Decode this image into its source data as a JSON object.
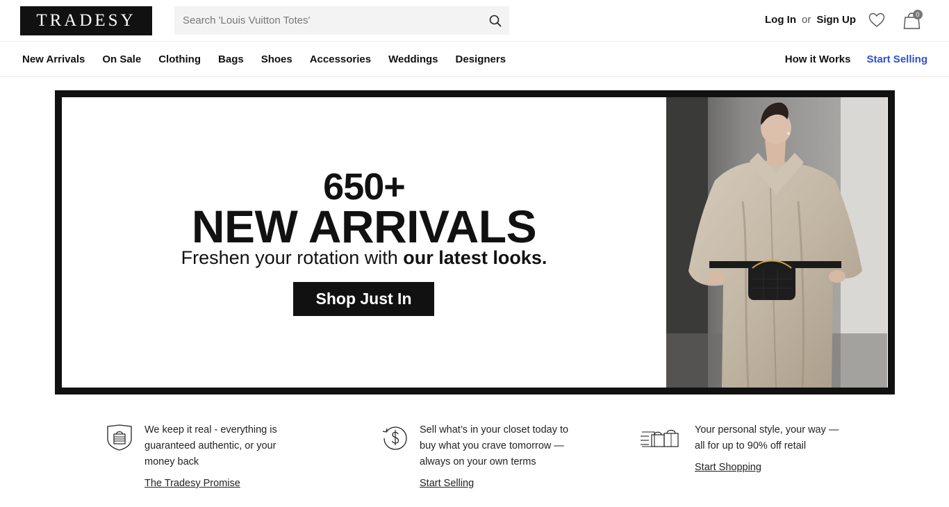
{
  "header": {
    "logo_text": "TRADESY",
    "search_placeholder": "Search 'Louis Vuitton Totes'",
    "search_icon": "search-icon",
    "login_label": "Log In",
    "or_label": "or",
    "signup_label": "Sign Up",
    "favorites_icon": "heart-icon",
    "cart_icon": "shopping-bag-icon",
    "cart_count": "0"
  },
  "nav": {
    "items": [
      {
        "label": "New Arrivals"
      },
      {
        "label": "On Sale"
      },
      {
        "label": "Clothing"
      },
      {
        "label": "Bags"
      },
      {
        "label": "Shoes"
      },
      {
        "label": "Accessories"
      },
      {
        "label": "Weddings"
      },
      {
        "label": "Designers"
      }
    ],
    "how_it_works": "How it Works",
    "start_selling": "Start Selling",
    "accent_color": "#2d4fd1"
  },
  "hero": {
    "count": "650+",
    "title": "NEW ARRIVALS",
    "subtitle_plain": "Freshen your rotation with ",
    "subtitle_bold": "our latest looks.",
    "cta_label": "Shop Just In"
  },
  "features": [
    {
      "icon": "shield-bag-icon",
      "text": "We keep it real - everything is guaranteed authentic, or your money back",
      "link": "The Tradesy Promise"
    },
    {
      "icon": "dollar-cycle-icon",
      "text": "Sell what’s in your closet today to buy what you crave tomorrow — always on your own terms",
      "link": "Start Selling"
    },
    {
      "icon": "moving-bags-icon",
      "text": "Your personal style, your way — all for up to 90% off retail",
      "link": "Start Shopping"
    }
  ]
}
